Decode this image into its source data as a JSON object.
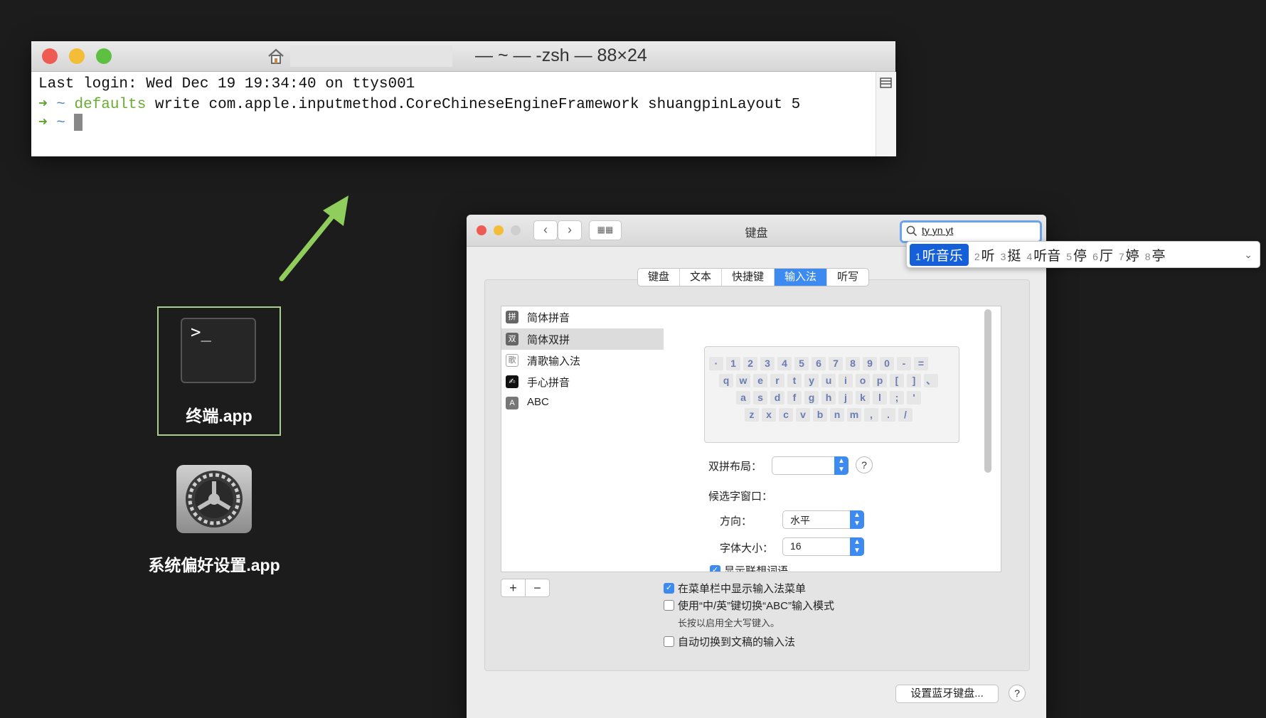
{
  "terminal": {
    "title": "— ~ — -zsh — 88×24",
    "lines": {
      "login": "Last login: Wed Dec 19 19:34:40 on ttys001",
      "prompt_arrow": "➜",
      "prompt_dir": "~",
      "cmd_name": "defaults",
      "cmd_args": " write com.apple.inputmethod.CoreChineseEngineFramework shuangpinLayout 5"
    }
  },
  "desktop": {
    "terminal_app_label": "终端.app",
    "terminal_prompt_glyph": ">_",
    "prefs_app_label": "系统偏好设置.app"
  },
  "prefs": {
    "title": "键盘",
    "search_value": "ty yn yt",
    "tabs": [
      "键盘",
      "文本",
      "快捷键",
      "输入法",
      "听写"
    ],
    "active_tab": "输入法",
    "input_methods": [
      {
        "icon": "拼",
        "label": "简体拼音"
      },
      {
        "icon": "双",
        "label": "简体双拼",
        "selected": true
      },
      {
        "icon": "歌",
        "label": "清歌输入法"
      },
      {
        "icon": "✍",
        "label": "手心拼音"
      },
      {
        "icon": "A",
        "label": "ABC"
      }
    ],
    "keyboard_rows": [
      [
        "·",
        "1",
        "2",
        "3",
        "4",
        "5",
        "6",
        "7",
        "8",
        "9",
        "0",
        "-",
        "="
      ],
      [
        "q",
        "w",
        "e",
        "r",
        "t",
        "y",
        "u",
        "i",
        "o",
        "p",
        "[",
        "]",
        "、"
      ],
      [
        "a",
        "s",
        "d",
        "f",
        "g",
        "h",
        "j",
        "k",
        "l",
        ";",
        "'"
      ],
      [
        "z",
        "x",
        "c",
        "v",
        "b",
        "n",
        "m",
        ",",
        ".",
        "/"
      ]
    ],
    "layout_label": "双拼布局：",
    "layout_value": "",
    "candidate_window_label": "候选字窗口：",
    "direction_label": "方向：",
    "direction_value": "水平",
    "font_size_label": "字体大小：",
    "font_size_value": "16",
    "show_assoc_label": "显示联想词语",
    "opt_menu_bar": "在菜单栏中显示输入法菜单",
    "opt_caps": "使用“中/英”键切换“ABC”输入模式",
    "opt_caps_hint": "长按以启用全大写键入。",
    "opt_auto_switch": "自动切换到文稿的输入法",
    "bluetooth_button": "设置蓝牙键盘...",
    "help": "?",
    "plus": "+",
    "minus": "−"
  },
  "candidates": [
    {
      "num": "1",
      "text": "听音乐"
    },
    {
      "num": "2",
      "text": "听"
    },
    {
      "num": "3",
      "text": "挺"
    },
    {
      "num": "4",
      "text": "听音"
    },
    {
      "num": "5",
      "text": "停"
    },
    {
      "num": "6",
      "text": "厅"
    },
    {
      "num": "7",
      "text": "婷"
    },
    {
      "num": "8",
      "text": "亭"
    }
  ],
  "colors": {
    "accent": "#3d8bf0",
    "candidate_highlight": "#1560d8",
    "arrow": "#8fcd5c",
    "prompt_green": "#5aa52c"
  }
}
